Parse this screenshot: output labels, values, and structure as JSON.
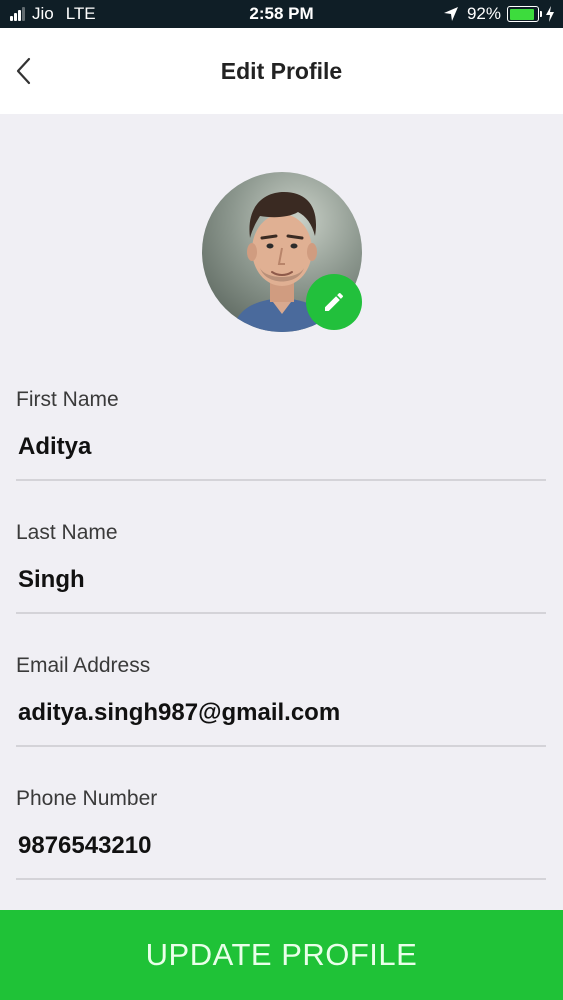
{
  "status_bar": {
    "carrier": "Jio",
    "network": "LTE",
    "time": "2:58 PM",
    "battery_percent": "92%",
    "battery_level": 0.92,
    "icons": [
      "signal-icon",
      "location-arrow-icon",
      "battery-icon",
      "charging-bolt-icon"
    ]
  },
  "header": {
    "title": "Edit Profile",
    "back_icon": "chevron-left-icon"
  },
  "avatar": {
    "edit_icon": "pencil-icon",
    "edit_color": "#22c03c"
  },
  "form": {
    "first_name": {
      "label": "First Name",
      "value": "Aditya"
    },
    "last_name": {
      "label": "Last Name",
      "value": "Singh"
    },
    "email": {
      "label": "Email Address",
      "value": "aditya.singh987@gmail.com"
    },
    "phone": {
      "label": "Phone Number",
      "value": "9876543210"
    }
  },
  "actions": {
    "update_label": "UPDATE PROFILE",
    "update_color": "#1fc237"
  }
}
